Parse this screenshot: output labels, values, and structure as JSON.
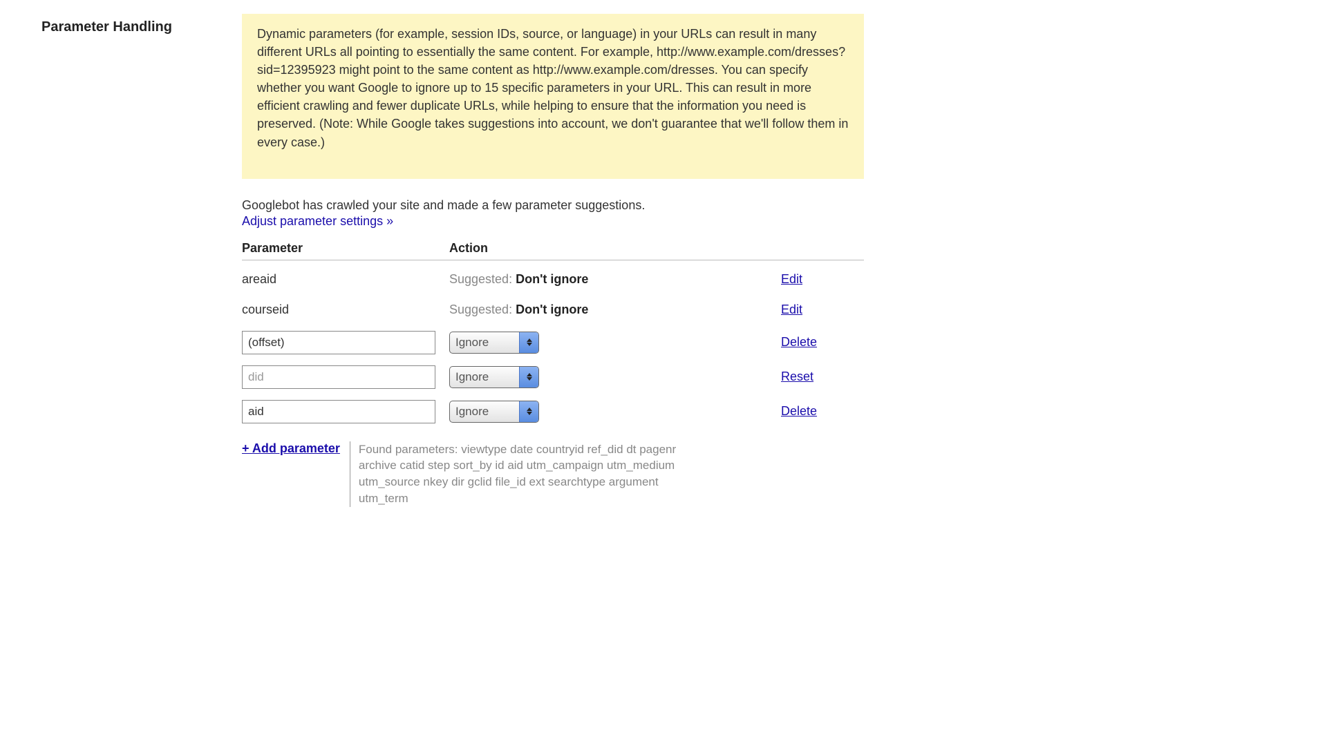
{
  "section_title": "Parameter Handling",
  "info_text": "Dynamic parameters (for example, session IDs, source, or language) in your URLs can result in many different URLs all pointing to essentially the same content. For example, http://www.example.com/dresses?sid=12395923 might point to the same content as http://www.example.com/dresses. You can specify whether you want Google to ignore up to 15 specific parameters in your URL. This can result in more efficient crawling and fewer duplicate URLs, while helping to ensure that the information you need is preserved. (Note: While Google takes suggestions into account, we don't guarantee that we'll follow them in every case.)",
  "suggestion_text": "Googlebot has crawled your site and made a few parameter suggestions.",
  "adjust_link": "Adjust parameter settings »",
  "columns": {
    "parameter": "Parameter",
    "action": "Action"
  },
  "suggested_label": "Suggested: ",
  "rows": [
    {
      "name": "areaid",
      "type": "static",
      "suggested": "Don't ignore",
      "link": "Edit"
    },
    {
      "name": "courseid",
      "type": "static",
      "suggested": "Don't ignore",
      "link": "Edit"
    },
    {
      "name": "(offset)",
      "type": "input",
      "select": "Ignore",
      "link": "Delete",
      "muted": false
    },
    {
      "name": "did",
      "type": "input",
      "select": "Ignore",
      "link": "Reset",
      "muted": true
    },
    {
      "name": "aid",
      "type": "input",
      "select": "Ignore",
      "link": "Delete",
      "muted": false
    }
  ],
  "add_parameter": "+ Add parameter",
  "found_parameters_label": "Found parameters: ",
  "found_parameters": "viewtype date countryid ref_did dt pagenr archive catid step sort_by id aid utm_campaign utm_medium utm_source nkey dir gclid file_id ext searchtype argument utm_term"
}
